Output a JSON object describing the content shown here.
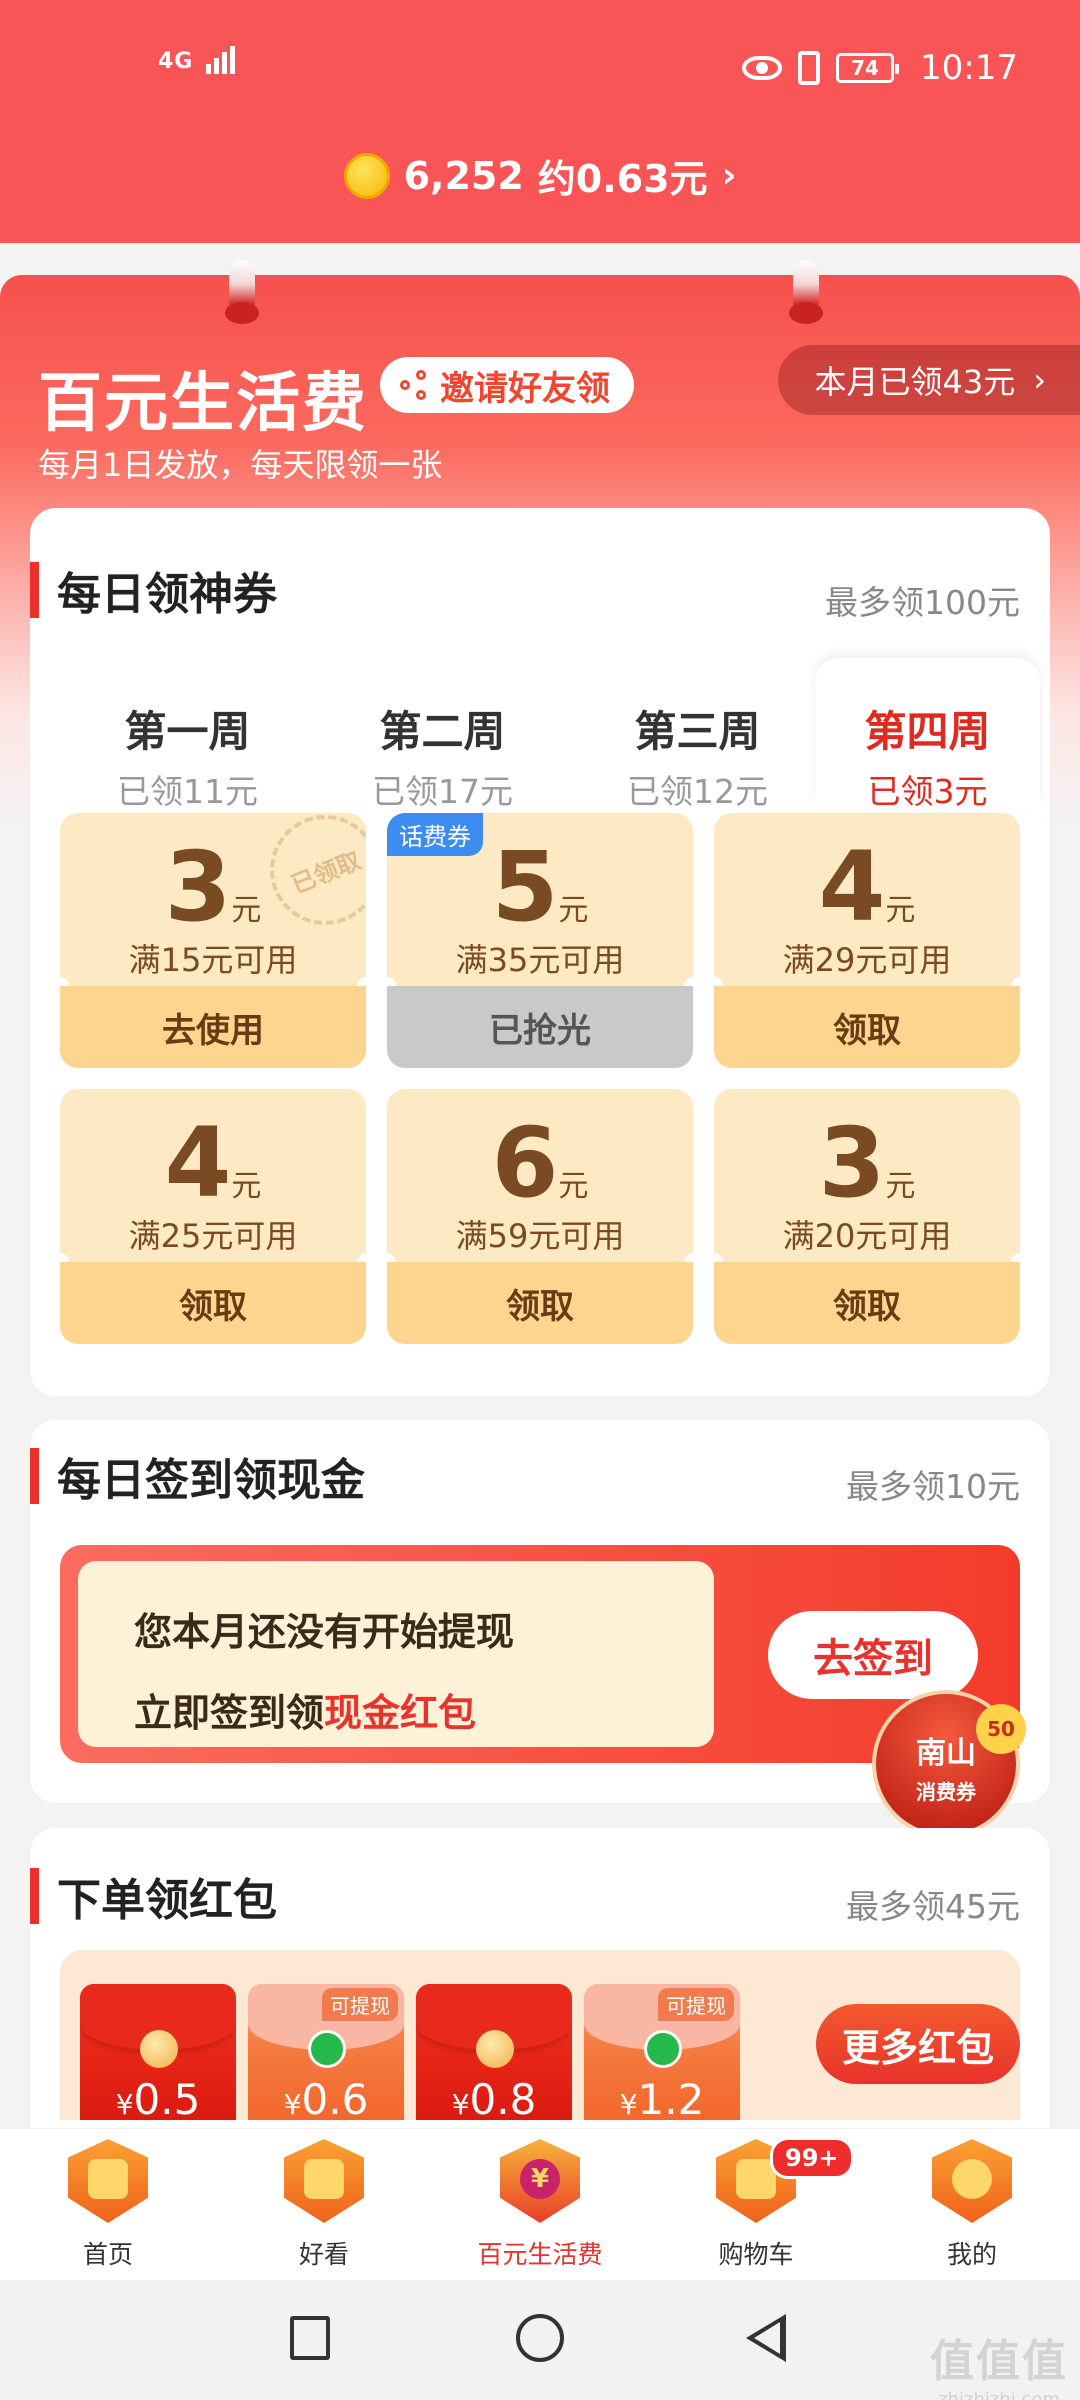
{
  "status_bar": {
    "network": "4G",
    "battery": "74",
    "time": "10:17"
  },
  "header": {
    "coins": "6,252",
    "approx": "约0.63元",
    "chevron": "›"
  },
  "banner": {
    "title": "百元生活费",
    "invite_label": "邀请好友领",
    "monthly_label": "本月已领43元",
    "monthly_chevron": "›",
    "subtitle": "每月1日发放，每天限领一张"
  },
  "daily_coupons": {
    "title": "每日领神券",
    "max_label": "最多领100元",
    "weeks": [
      {
        "name": "第一周",
        "value": "已领11元"
      },
      {
        "name": "第二周",
        "value": "已领17元"
      },
      {
        "name": "第三周",
        "value": "已领12元"
      },
      {
        "name": "第四周",
        "value": "已领3元"
      }
    ],
    "active_week": 3,
    "coupons": [
      {
        "amount": "3",
        "unit": "元",
        "condition": "满15元可用",
        "button": "去使用",
        "stamp": "已领取"
      },
      {
        "amount": "5",
        "unit": "元",
        "condition": "满35元可用",
        "button": "已抢光",
        "tag": "话费券"
      },
      {
        "amount": "4",
        "unit": "元",
        "condition": "满29元可用",
        "button": "领取"
      },
      {
        "amount": "4",
        "unit": "元",
        "condition": "满25元可用",
        "button": "领取"
      },
      {
        "amount": "6",
        "unit": "元",
        "condition": "满59元可用",
        "button": "领取"
      },
      {
        "amount": "3",
        "unit": "元",
        "condition": "满20元可用",
        "button": "领取"
      }
    ]
  },
  "daily_signin": {
    "title": "每日签到领现金",
    "max_label": "最多领10元",
    "line1": "您本月还没有开始提现",
    "line2_prefix": "立即签到领",
    "line2_highlight": "现金红包",
    "button": "去签到"
  },
  "floating_badge": {
    "line1": "南山",
    "line2": "消费券",
    "value": "50"
  },
  "order_redpacket": {
    "title": "下单领红包",
    "max_label": "最多领45元",
    "currency": "¥",
    "packets": [
      {
        "amount": "0.5",
        "withdrawable": ""
      },
      {
        "amount": "0.6",
        "withdrawable": "可提现"
      },
      {
        "amount": "0.8",
        "withdrawable": ""
      },
      {
        "amount": "1.2",
        "withdrawable": "可提现"
      }
    ],
    "more_button": "更多红包"
  },
  "tabbar": {
    "tabs": [
      {
        "label": "首页",
        "icon": "home-icon"
      },
      {
        "label": "好看",
        "icon": "video-icon"
      },
      {
        "label": "百元生活费",
        "icon": "yuan-icon",
        "glyph": "¥"
      },
      {
        "label": "购物车",
        "icon": "cart-icon"
      },
      {
        "label": "我的",
        "icon": "profile-icon"
      }
    ],
    "cart_badge": "99+"
  },
  "watermark": {
    "line1": "值值值",
    "line2": "zhizhizhi.com"
  }
}
